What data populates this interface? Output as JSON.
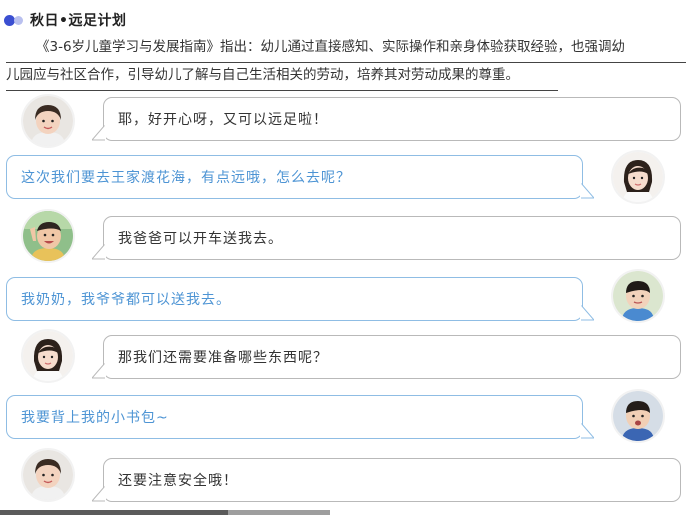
{
  "header": {
    "title": "秋日•远足计划"
  },
  "intro": {
    "line1": "《3-6岁儿童学习与发展指南》指出：幼儿通过直接感知、实际操作和亲身体验获取经验，也强调幼",
    "line2": "儿园应与社区合作，引导幼儿了解与自己生活相关的劳动，培养其对劳动成果的尊重。"
  },
  "colors": {
    "accent": "#3b4fd1",
    "right_text": "#4d94d4",
    "right_border": "#8fbde4",
    "left_border": "#b9b9b9"
  },
  "chat": {
    "messages": [
      {
        "side": "left",
        "text": "耶，好开心呀，又可以远足啦！"
      },
      {
        "side": "right",
        "text": "这次我们要去王家渡花海，有点远哦，怎么去呢？"
      },
      {
        "side": "left",
        "text": "我爸爸可以开车送我去。"
      },
      {
        "side": "right",
        "text": "我奶奶，我爷爷都可以送我去。"
      },
      {
        "side": "left",
        "text": "那我们还需要准备哪些东西呢？"
      },
      {
        "side": "right",
        "text": "我要背上我的小书包~"
      },
      {
        "side": "left",
        "text": "还要注意安全哦！"
      }
    ]
  }
}
